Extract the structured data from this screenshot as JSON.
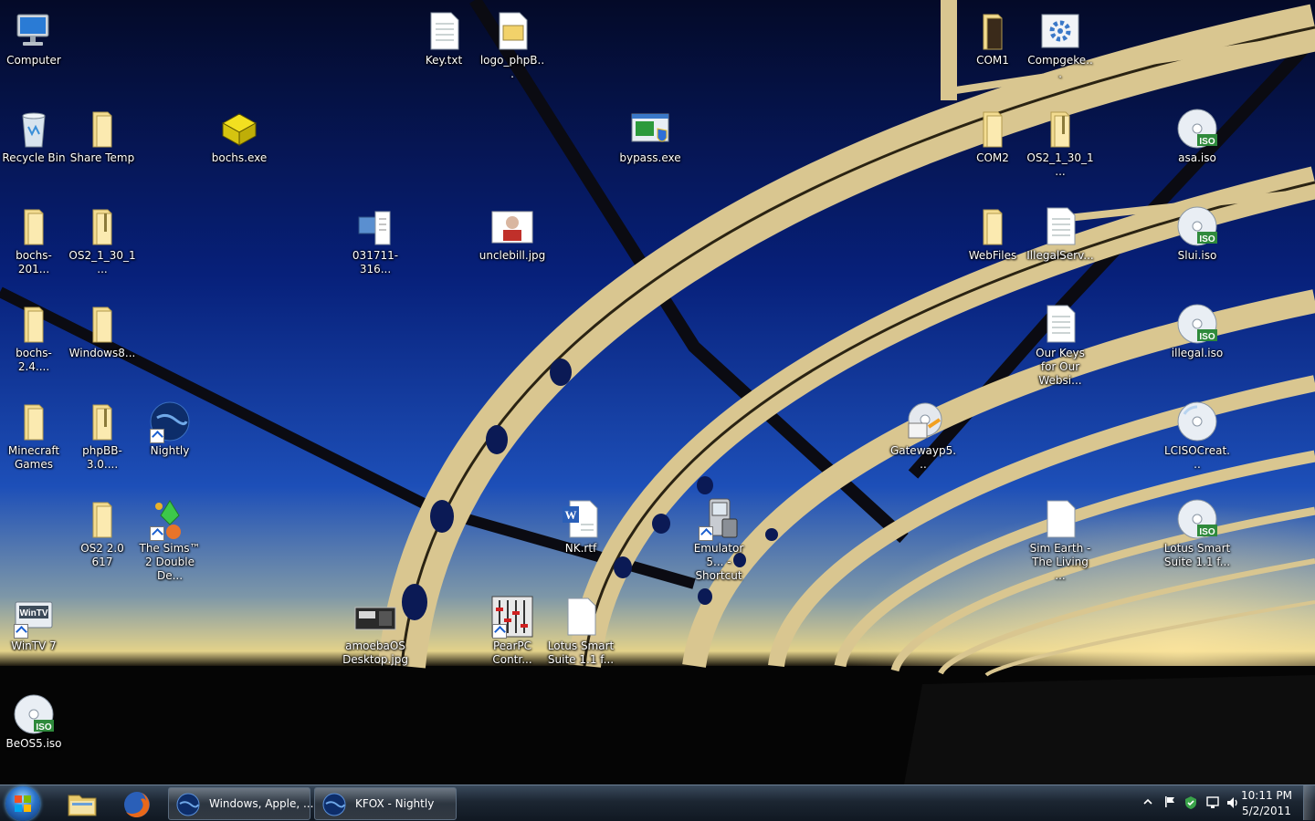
{
  "desktop": {
    "icons": [
      {
        "label": "Computer"
      },
      {
        "label": "Key.txt"
      },
      {
        "label": "logo_phpB..."
      },
      {
        "label": "COM1"
      },
      {
        "label": "Compgeke..."
      },
      {
        "label": "Recycle Bin"
      },
      {
        "label": "Share Temp"
      },
      {
        "label": "bochs.exe"
      },
      {
        "label": "bypass.exe"
      },
      {
        "label": "COM2"
      },
      {
        "label": "OS2_1_30_1..."
      },
      {
        "label": "asa.iso"
      },
      {
        "label": "bochs-201..."
      },
      {
        "label": "OS2_1_30_1..."
      },
      {
        "label": "031711-316..."
      },
      {
        "label": "unclebill.jpg"
      },
      {
        "label": "WebFiles"
      },
      {
        "label": "IllegalServ..."
      },
      {
        "label": "Slui.iso"
      },
      {
        "label": "bochs-2.4...."
      },
      {
        "label": "Windows8..."
      },
      {
        "label": "Our Keys for Our Websi..."
      },
      {
        "label": "illegal.iso"
      },
      {
        "label": "Minecraft Games"
      },
      {
        "label": "phpBB-3.0...."
      },
      {
        "label": "Nightly"
      },
      {
        "label": "Gatewayp5..."
      },
      {
        "label": "LCISOCreat..."
      },
      {
        "label": "OS2 2.0 617"
      },
      {
        "label": "The Sims™ 2 Double De..."
      },
      {
        "label": "NK.rtf"
      },
      {
        "label": "Emulator 5... - Shortcut"
      },
      {
        "label": "Sim Earth - The Living ..."
      },
      {
        "label": "Lotus Smart Suite 1.1 f..."
      },
      {
        "label": "WinTV 7"
      },
      {
        "label": "amoebaOS Desktop.jpg"
      },
      {
        "label": "PearPC Contr..."
      },
      {
        "label": "Lotus Smart Suite 1.1 f..."
      },
      {
        "label": "BeOS5.iso"
      }
    ]
  },
  "taskbar": {
    "pinned": [
      {
        "icon": "windows-explorer-icon"
      },
      {
        "icon": "firefox-icon"
      }
    ],
    "tasks": [
      {
        "label": "Windows, Apple, ..."
      },
      {
        "label": "KFOX - Nightly"
      }
    ],
    "clock": {
      "time": "10:11 PM",
      "date": "5/2/2011"
    }
  },
  "colors": {
    "sky_top": "#050b2e",
    "sky_mid": "#0b2a8a",
    "horizon": "#d8d07a",
    "bridge": "#d9c690",
    "taskbar": "#1c2632"
  }
}
